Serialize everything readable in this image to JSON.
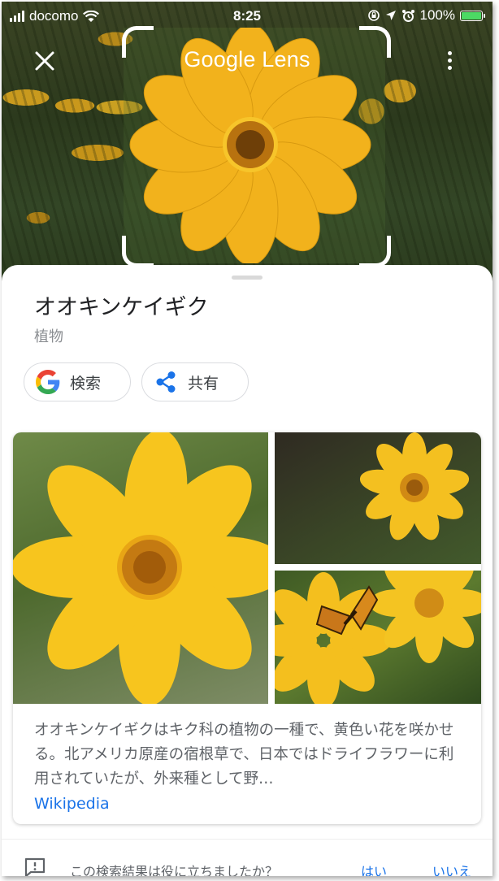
{
  "status_bar": {
    "carrier": "docomo",
    "time": "8:25",
    "battery": "100%",
    "battery_level": 1.0,
    "icons": [
      "signal-icon",
      "wifi-icon",
      "rotation-lock-icon",
      "location-icon",
      "alarm-icon",
      "battery-charging-icon"
    ]
  },
  "header": {
    "title": "Google Lens",
    "close_icon": "close-icon",
    "menu_icon": "more-vert-icon"
  },
  "result": {
    "name": "オオキンケイギク",
    "category": "植物",
    "actions": [
      {
        "label": "検索",
        "icon": "google-g-icon"
      },
      {
        "label": "共有",
        "icon": "share-icon"
      }
    ],
    "description": "オオキンケイギクはキク科の植物の一種で、黄色い花を咲かせる。北アメリカ原産の宿根草で、日本ではドライフラワーに利用されていたが、外来種として野…",
    "source": "Wikipedia"
  },
  "feedback": {
    "question": "この検索結果は役に立ちましたか？",
    "yes": "はい",
    "no": "いいえ",
    "icon": "feedback-icon"
  },
  "colors": {
    "accent": "#1a73e8",
    "flower_yellow": "#f4b51c",
    "flower_center": "#c47a12",
    "text_primary": "#202124",
    "text_secondary": "#5f6368"
  }
}
